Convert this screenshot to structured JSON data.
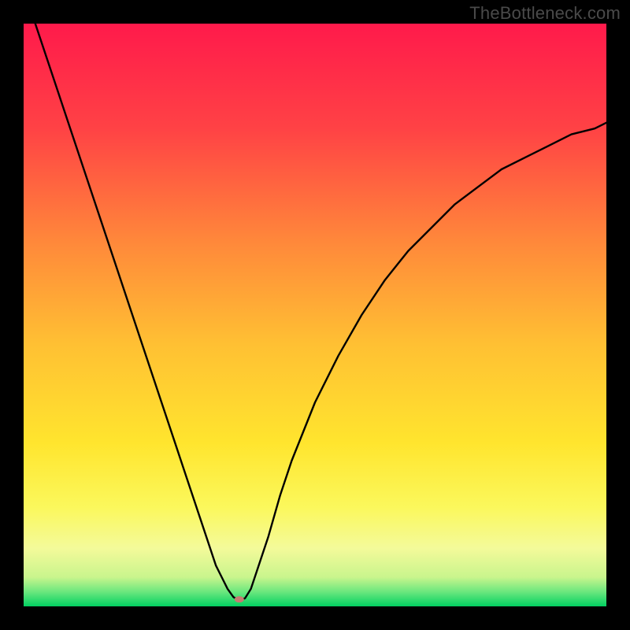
{
  "watermark": "TheBottleneck.com",
  "chart_data": {
    "type": "line",
    "title": "",
    "xlabel": "",
    "ylabel": "",
    "xlim": [
      0,
      100
    ],
    "ylim": [
      0,
      100
    ],
    "legend": false,
    "grid": false,
    "background_gradient": {
      "stops": [
        {
          "pos": 0.0,
          "color": "#ff1a4b"
        },
        {
          "pos": 0.18,
          "color": "#ff4245"
        },
        {
          "pos": 0.38,
          "color": "#ff8a3a"
        },
        {
          "pos": 0.55,
          "color": "#ffc033"
        },
        {
          "pos": 0.72,
          "color": "#ffe52e"
        },
        {
          "pos": 0.83,
          "color": "#fbf85c"
        },
        {
          "pos": 0.9,
          "color": "#f4fa9a"
        },
        {
          "pos": 0.95,
          "color": "#c9f58d"
        },
        {
          "pos": 0.975,
          "color": "#6be77e"
        },
        {
          "pos": 1.0,
          "color": "#02d061"
        }
      ]
    },
    "optimum": {
      "x": 37,
      "y": 1.2
    },
    "marker": {
      "x": 37,
      "y": 1.2,
      "color": "#c77b72",
      "rx": 6,
      "ry": 4
    },
    "series": [
      {
        "name": "bottleneck-curve",
        "color": "#000000",
        "width": 2.4,
        "x": [
          2,
          4,
          6,
          8,
          10,
          12,
          14,
          16,
          18,
          20,
          22,
          24,
          26,
          28,
          30,
          32,
          33,
          34,
          35,
          36,
          37,
          38,
          39,
          40,
          42,
          44,
          46,
          48,
          50,
          54,
          58,
          62,
          66,
          70,
          74,
          78,
          82,
          86,
          90,
          94,
          98,
          100
        ],
        "y": [
          100,
          94,
          88,
          82,
          76,
          70,
          64,
          58,
          52,
          46,
          40,
          34,
          28,
          22,
          16,
          10,
          7,
          5,
          3,
          1.6,
          1.0,
          1.4,
          3,
          6,
          12,
          19,
          25,
          30,
          35,
          43,
          50,
          56,
          61,
          65,
          69,
          72,
          75,
          77,
          79,
          81,
          82,
          83
        ]
      }
    ]
  }
}
